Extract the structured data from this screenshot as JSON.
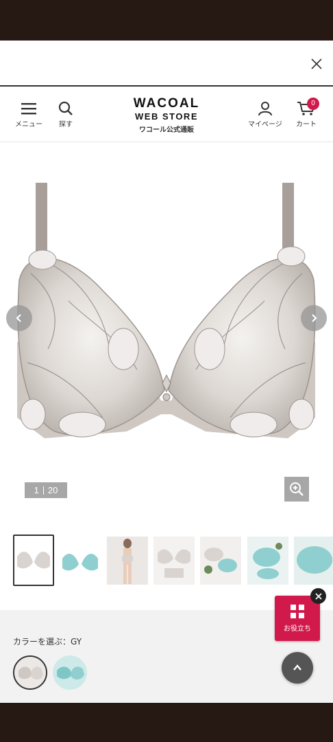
{
  "header": {
    "menu_label": "メニュー",
    "search_label": "探す",
    "logo_line1": "WACOAL",
    "logo_line2": "WEB STORE",
    "logo_subtitle": "ワコール公式通販",
    "mypage_label": "マイページ",
    "cart_label": "カート",
    "cart_count": "0"
  },
  "gallery": {
    "current": "1",
    "total": "20"
  },
  "color": {
    "label": "カラーを選ぶ：GY",
    "options": [
      "GY",
      "BL"
    ]
  },
  "help": {
    "label": "お役立ち"
  },
  "colors": {
    "accent": "#d2194c",
    "dark_bar": "#261914",
    "counter_bg": "#a7a7a7"
  }
}
